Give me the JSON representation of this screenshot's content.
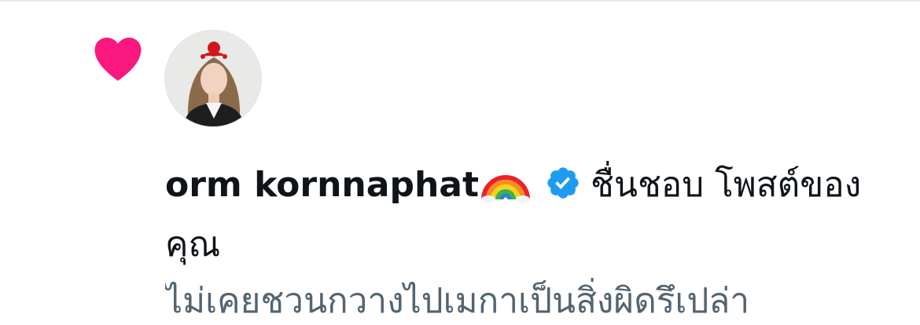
{
  "notification": {
    "type_icon": "heart-icon",
    "accent_color": "#f91880",
    "avatar_icon": "avatar",
    "user_name": "orm kornnaphat",
    "name_emoji": "rainbow-emoji",
    "verified_icon": "verified-badge-icon",
    "verified_color": "#1d9bf0",
    "action_text": "ชื่นชอบ โพสต์ของคุณ",
    "post_preview": "ไม่เคยชวนกวางไปเมกาเป็นสิ่งผิดรึเปล่า"
  }
}
